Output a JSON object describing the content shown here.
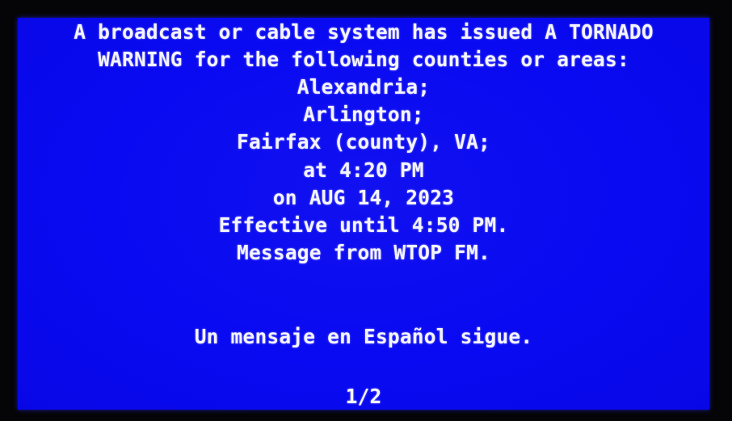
{
  "alert": {
    "headline_lines": [
      "A broadcast or cable system has issued A TORNADO",
      "WARNING for the following counties or areas:"
    ],
    "areas": [
      "Alexandria;",
      "Arlington;",
      "Fairfax (county), VA;"
    ],
    "issued_time": "at 4:20 PM",
    "issued_date": "on AUG 14, 2023",
    "effective_until": "Effective until 4:50 PM.",
    "source": "Message from WTOP FM.",
    "spanish_notice": "Un mensaje en Español sigue.",
    "page_indicator": "1/2"
  },
  "colors": {
    "screen_background": "#0a0af2",
    "text": "#f4f4ff",
    "bezel": "#050507"
  }
}
